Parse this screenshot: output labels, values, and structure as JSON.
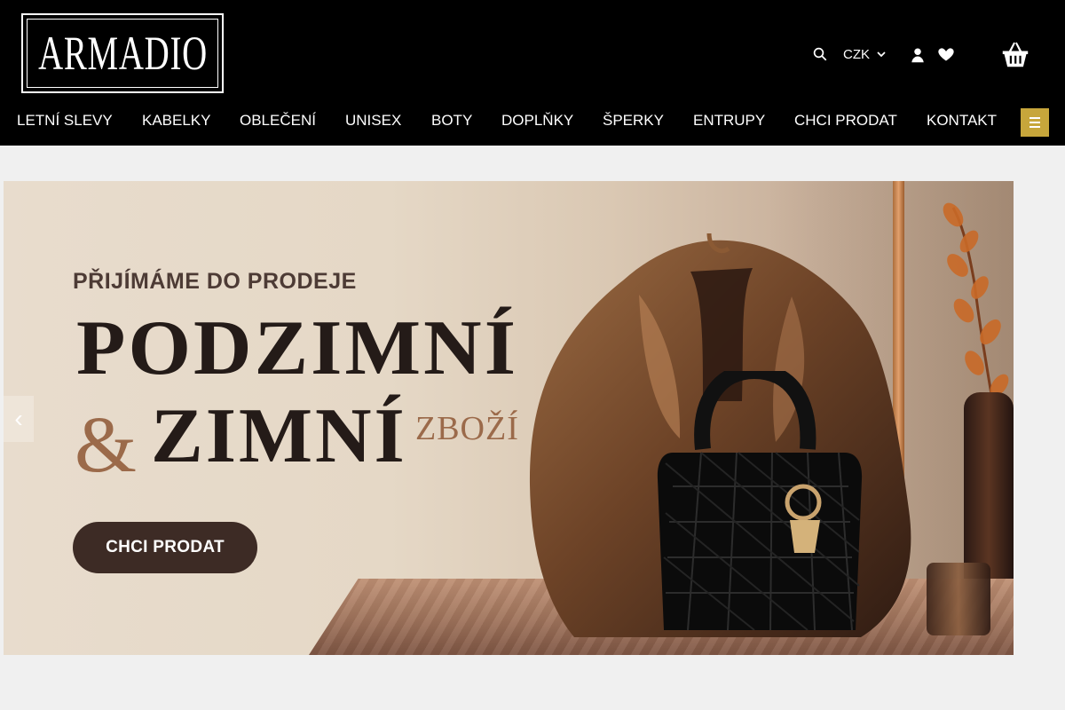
{
  "brand": {
    "logo_text": "ARMADIO",
    "accent_color": "#c7a63b"
  },
  "header_tools": {
    "currency": "CZK",
    "icons": [
      "search-icon",
      "chevron-down-icon",
      "user-icon",
      "heart-icon",
      "shopping-basket-icon",
      "menu-icon"
    ]
  },
  "navigation": {
    "items": [
      "LETNÍ SLEVY",
      "KABELKY",
      "OBLEČENÍ",
      "UNISEX",
      "BOTY",
      "DOPLŇKY",
      "ŠPERKY",
      "ENTRUPY",
      "CHCI PRODAT",
      "KONTAKT"
    ]
  },
  "hero": {
    "eyebrow": "PŘIJÍMÁME DO PRODEJE",
    "headline_line_1": "PODZIMNÍ",
    "ampersand": "&",
    "headline_line_2": "ZIMNÍ",
    "headline_small": "ZBOŽÍ",
    "cta_label": "CHCI PRODAT",
    "colors": {
      "headline": "#241b18",
      "accent": "#9b6a4a",
      "button": "#3d2b25"
    }
  }
}
